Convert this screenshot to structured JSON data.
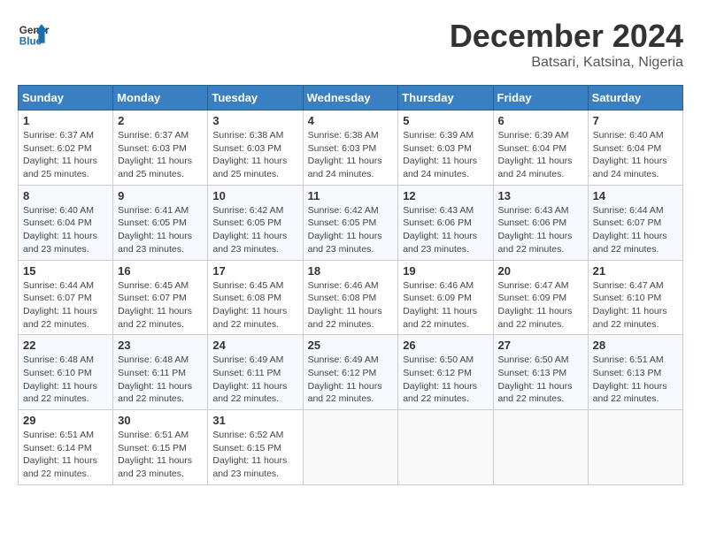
{
  "header": {
    "logo_general": "General",
    "logo_blue": "Blue",
    "month_title": "December 2024",
    "subtitle": "Batsari, Katsina, Nigeria"
  },
  "calendar": {
    "columns": [
      "Sunday",
      "Monday",
      "Tuesday",
      "Wednesday",
      "Thursday",
      "Friday",
      "Saturday"
    ],
    "weeks": [
      [
        {
          "day": "1",
          "info": "Sunrise: 6:37 AM\nSunset: 6:02 PM\nDaylight: 11 hours and 25 minutes."
        },
        {
          "day": "2",
          "info": "Sunrise: 6:37 AM\nSunset: 6:03 PM\nDaylight: 11 hours and 25 minutes."
        },
        {
          "day": "3",
          "info": "Sunrise: 6:38 AM\nSunset: 6:03 PM\nDaylight: 11 hours and 25 minutes."
        },
        {
          "day": "4",
          "info": "Sunrise: 6:38 AM\nSunset: 6:03 PM\nDaylight: 11 hours and 24 minutes."
        },
        {
          "day": "5",
          "info": "Sunrise: 6:39 AM\nSunset: 6:03 PM\nDaylight: 11 hours and 24 minutes."
        },
        {
          "day": "6",
          "info": "Sunrise: 6:39 AM\nSunset: 6:04 PM\nDaylight: 11 hours and 24 minutes."
        },
        {
          "day": "7",
          "info": "Sunrise: 6:40 AM\nSunset: 6:04 PM\nDaylight: 11 hours and 24 minutes."
        }
      ],
      [
        {
          "day": "8",
          "info": "Sunrise: 6:40 AM\nSunset: 6:04 PM\nDaylight: 11 hours and 23 minutes."
        },
        {
          "day": "9",
          "info": "Sunrise: 6:41 AM\nSunset: 6:05 PM\nDaylight: 11 hours and 23 minutes."
        },
        {
          "day": "10",
          "info": "Sunrise: 6:42 AM\nSunset: 6:05 PM\nDaylight: 11 hours and 23 minutes."
        },
        {
          "day": "11",
          "info": "Sunrise: 6:42 AM\nSunset: 6:05 PM\nDaylight: 11 hours and 23 minutes."
        },
        {
          "day": "12",
          "info": "Sunrise: 6:43 AM\nSunset: 6:06 PM\nDaylight: 11 hours and 23 minutes."
        },
        {
          "day": "13",
          "info": "Sunrise: 6:43 AM\nSunset: 6:06 PM\nDaylight: 11 hours and 22 minutes."
        },
        {
          "day": "14",
          "info": "Sunrise: 6:44 AM\nSunset: 6:07 PM\nDaylight: 11 hours and 22 minutes."
        }
      ],
      [
        {
          "day": "15",
          "info": "Sunrise: 6:44 AM\nSunset: 6:07 PM\nDaylight: 11 hours and 22 minutes."
        },
        {
          "day": "16",
          "info": "Sunrise: 6:45 AM\nSunset: 6:07 PM\nDaylight: 11 hours and 22 minutes."
        },
        {
          "day": "17",
          "info": "Sunrise: 6:45 AM\nSunset: 6:08 PM\nDaylight: 11 hours and 22 minutes."
        },
        {
          "day": "18",
          "info": "Sunrise: 6:46 AM\nSunset: 6:08 PM\nDaylight: 11 hours and 22 minutes."
        },
        {
          "day": "19",
          "info": "Sunrise: 6:46 AM\nSunset: 6:09 PM\nDaylight: 11 hours and 22 minutes."
        },
        {
          "day": "20",
          "info": "Sunrise: 6:47 AM\nSunset: 6:09 PM\nDaylight: 11 hours and 22 minutes."
        },
        {
          "day": "21",
          "info": "Sunrise: 6:47 AM\nSunset: 6:10 PM\nDaylight: 11 hours and 22 minutes."
        }
      ],
      [
        {
          "day": "22",
          "info": "Sunrise: 6:48 AM\nSunset: 6:10 PM\nDaylight: 11 hours and 22 minutes."
        },
        {
          "day": "23",
          "info": "Sunrise: 6:48 AM\nSunset: 6:11 PM\nDaylight: 11 hours and 22 minutes."
        },
        {
          "day": "24",
          "info": "Sunrise: 6:49 AM\nSunset: 6:11 PM\nDaylight: 11 hours and 22 minutes."
        },
        {
          "day": "25",
          "info": "Sunrise: 6:49 AM\nSunset: 6:12 PM\nDaylight: 11 hours and 22 minutes."
        },
        {
          "day": "26",
          "info": "Sunrise: 6:50 AM\nSunset: 6:12 PM\nDaylight: 11 hours and 22 minutes."
        },
        {
          "day": "27",
          "info": "Sunrise: 6:50 AM\nSunset: 6:13 PM\nDaylight: 11 hours and 22 minutes."
        },
        {
          "day": "28",
          "info": "Sunrise: 6:51 AM\nSunset: 6:13 PM\nDaylight: 11 hours and 22 minutes."
        }
      ],
      [
        {
          "day": "29",
          "info": "Sunrise: 6:51 AM\nSunset: 6:14 PM\nDaylight: 11 hours and 22 minutes."
        },
        {
          "day": "30",
          "info": "Sunrise: 6:51 AM\nSunset: 6:15 PM\nDaylight: 11 hours and 23 minutes."
        },
        {
          "day": "31",
          "info": "Sunrise: 6:52 AM\nSunset: 6:15 PM\nDaylight: 11 hours and 23 minutes."
        },
        {
          "day": "",
          "info": ""
        },
        {
          "day": "",
          "info": ""
        },
        {
          "day": "",
          "info": ""
        },
        {
          "day": "",
          "info": ""
        }
      ]
    ]
  }
}
